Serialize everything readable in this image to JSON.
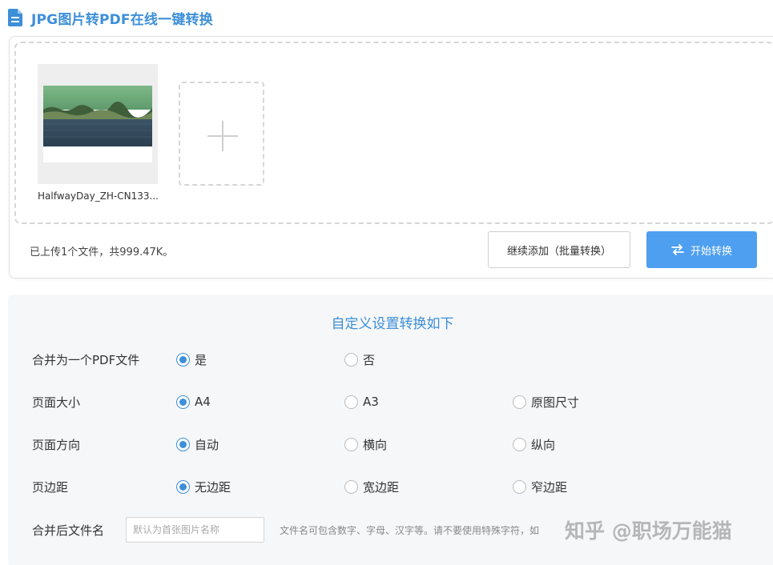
{
  "header": {
    "icon": "document-icon",
    "title": "JPG图片转PDF在线一键转换",
    "accent": "#3d8fd8"
  },
  "upload": {
    "files": [
      {
        "name": "HalfwayDay_ZH-CN133..."
      }
    ],
    "add_icon": "plus-icon",
    "status": "已上传1个文件，共999.47K。",
    "continue_label": "继续添加（批量转换）",
    "start_label": "开始转换",
    "start_icon": "swap-arrows-icon",
    "start_color": "#4e9ff0"
  },
  "settings": {
    "title": "自定义设置转换如下",
    "rows": [
      {
        "label": "合并为一个PDF文件",
        "options": [
          "是",
          "否"
        ],
        "selected": 0
      },
      {
        "label": "页面大小",
        "options": [
          "A4",
          "A3",
          "原图尺寸"
        ],
        "selected": 0
      },
      {
        "label": "页面方向",
        "options": [
          "自动",
          "横向",
          "纵向"
        ],
        "selected": 0
      },
      {
        "label": "页边距",
        "options": [
          "无边距",
          "宽边距",
          "窄边距"
        ],
        "selected": 0
      }
    ],
    "filename": {
      "label": "合并后文件名",
      "value": "",
      "placeholder": "默认为首张图片名称",
      "hint": "文件名可包含数字、字母、汉字等。请不要使用特殊字符，如"
    },
    "watermark": "知乎 @职场万能猫"
  }
}
